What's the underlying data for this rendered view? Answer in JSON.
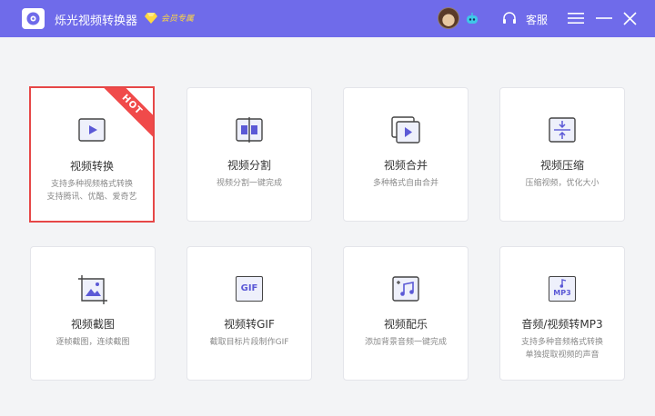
{
  "app": {
    "title": "烁光视频转换器",
    "vip_label": "会员专属",
    "service_label": "客服"
  },
  "colors": {
    "titlebar": "#6f6bea",
    "accent": "#5b59d6",
    "hot_ribbon": "#f04a4a",
    "active_border": "#e64747"
  },
  "tools": [
    {
      "title": "视频转换",
      "desc1": "支持多种视频格式转换",
      "desc2": "支持腾讯、优酷、爱奇艺",
      "icon": "video-convert-icon",
      "badge": "HOT"
    },
    {
      "title": "视频分割",
      "desc1": "视频分割一键完成",
      "desc2": "",
      "icon": "video-split-icon"
    },
    {
      "title": "视频合并",
      "desc1": "多种格式自由合并",
      "desc2": "",
      "icon": "video-merge-icon"
    },
    {
      "title": "视频压缩",
      "desc1": "压缩视频，优化大小",
      "desc2": "",
      "icon": "video-compress-icon"
    },
    {
      "title": "视频截图",
      "desc1": "逐帧截图，连续截图",
      "desc2": "",
      "icon": "video-screenshot-icon"
    },
    {
      "title": "视频转GIF",
      "desc1": "截取目标片段制作GIF",
      "desc2": "",
      "icon": "gif-icon",
      "icon_text": "GIF"
    },
    {
      "title": "视频配乐",
      "desc1": "添加背景音频一键完成",
      "desc2": "",
      "icon": "music-icon"
    },
    {
      "title": "音频/视频转MP3",
      "desc1": "支持多种音频格式转换",
      "desc2": "单独提取视频的声音",
      "icon": "mp3-icon",
      "icon_text": "MP3"
    }
  ]
}
